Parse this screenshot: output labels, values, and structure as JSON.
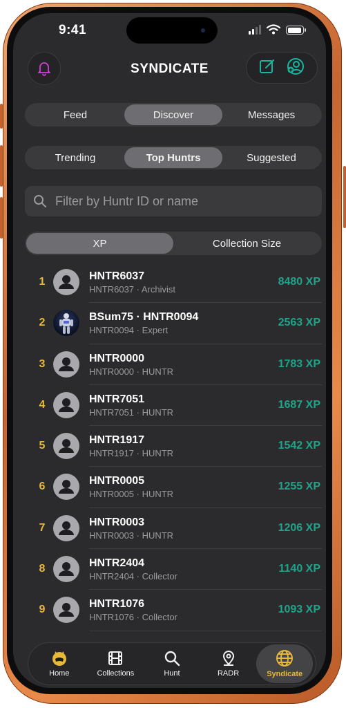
{
  "status_bar": {
    "time": "9:41"
  },
  "header": {
    "title": "SYNDICATE"
  },
  "top_tabs": [
    {
      "label": "Feed",
      "active": false
    },
    {
      "label": "Discover",
      "active": true
    },
    {
      "label": "Messages",
      "active": false
    }
  ],
  "sub_tabs": [
    {
      "label": "Trending",
      "active": false
    },
    {
      "label": "Top Huntrs",
      "active": true
    },
    {
      "label": "Suggested",
      "active": false
    }
  ],
  "search": {
    "placeholder": "Filter by Huntr ID or name"
  },
  "sort_tabs": [
    {
      "label": "XP",
      "active": true
    },
    {
      "label": "Collection Size",
      "active": false
    }
  ],
  "leaderboard": [
    {
      "rank": "1",
      "name": "HNTR6037",
      "subtitle": "HNTR6037 · Archivist",
      "xp": "8480 XP",
      "avatar": "default"
    },
    {
      "rank": "2",
      "name": "BSum75 · HNTR0094",
      "subtitle": "HNTR0094 · Expert",
      "xp": "2563 XP",
      "avatar": "robot"
    },
    {
      "rank": "3",
      "name": "HNTR0000",
      "subtitle": "HNTR0000 · HUNTR",
      "xp": "1783 XP",
      "avatar": "default"
    },
    {
      "rank": "4",
      "name": "HNTR7051",
      "subtitle": "HNTR7051 · HUNTR",
      "xp": "1687 XP",
      "avatar": "default"
    },
    {
      "rank": "5",
      "name": "HNTR1917",
      "subtitle": "HNTR1917 · HUNTR",
      "xp": "1542 XP",
      "avatar": "default"
    },
    {
      "rank": "6",
      "name": "HNTR0005",
      "subtitle": "HNTR0005 · HUNTR",
      "xp": "1255 XP",
      "avatar": "default"
    },
    {
      "rank": "7",
      "name": "HNTR0003",
      "subtitle": "HNTR0003 · HUNTR",
      "xp": "1206 XP",
      "avatar": "default"
    },
    {
      "rank": "8",
      "name": "HNTR2404",
      "subtitle": "HNTR2404 · Collector",
      "xp": "1140 XP",
      "avatar": "default"
    },
    {
      "rank": "9",
      "name": "HNTR1076",
      "subtitle": "HNTR1076 · Collector",
      "xp": "1093 XP",
      "avatar": "default"
    }
  ],
  "tab_bar": [
    {
      "label": "Home",
      "icon": "cat-face-icon",
      "active": false
    },
    {
      "label": "Collections",
      "icon": "film-frame-icon",
      "active": false
    },
    {
      "label": "Hunt",
      "icon": "search-icon",
      "active": false
    },
    {
      "label": "RADR",
      "icon": "location-pin-icon",
      "active": false
    },
    {
      "label": "Syndicate",
      "icon": "globe-icon",
      "active": true
    }
  ],
  "colors": {
    "background": "#2b2b2d",
    "accent_gold": "#e7b93b",
    "xp_teal": "#1fa489",
    "bell_magenta": "#d23fd6",
    "action_teal": "#19b7a0",
    "frame_orange": "#d9773c"
  }
}
